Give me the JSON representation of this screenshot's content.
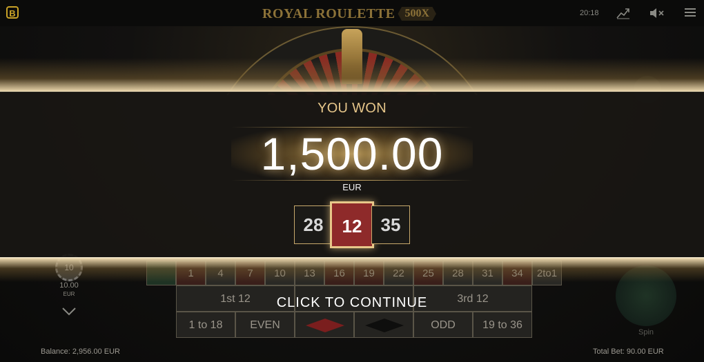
{
  "header": {
    "logo_letter": "B",
    "game_title": "ROYAL ROULETTE",
    "multiplier_badge": "500X",
    "clock": "20:18"
  },
  "win": {
    "heading": "YOU WON",
    "amount": "1,500.00",
    "currency": "EUR",
    "numbers": [
      "28",
      "12",
      "35"
    ],
    "continue_label": "CLICK TO CONTINUE"
  },
  "table": {
    "row_numbers": [
      "1",
      "4",
      "7",
      "10",
      "13",
      "16",
      "19",
      "22",
      "25",
      "28",
      "31",
      "34",
      "2to1"
    ],
    "dozens": [
      "1st 12",
      "",
      "3rd 12"
    ],
    "outside": [
      "1 to 18",
      "EVEN",
      "",
      "",
      "ODD",
      "19 to 36"
    ]
  },
  "chip": {
    "label": "10",
    "value": "10.00",
    "currency": "EUR"
  },
  "spin_label": "Spin",
  "footer": {
    "balance": "Balance: 2,956.00 EUR",
    "total_bet": "Total Bet: 90.00 EUR"
  },
  "colors": {
    "gold": "#c9a227",
    "win_red": "#8e2a2a",
    "heading_gold": "#e6c68a"
  }
}
